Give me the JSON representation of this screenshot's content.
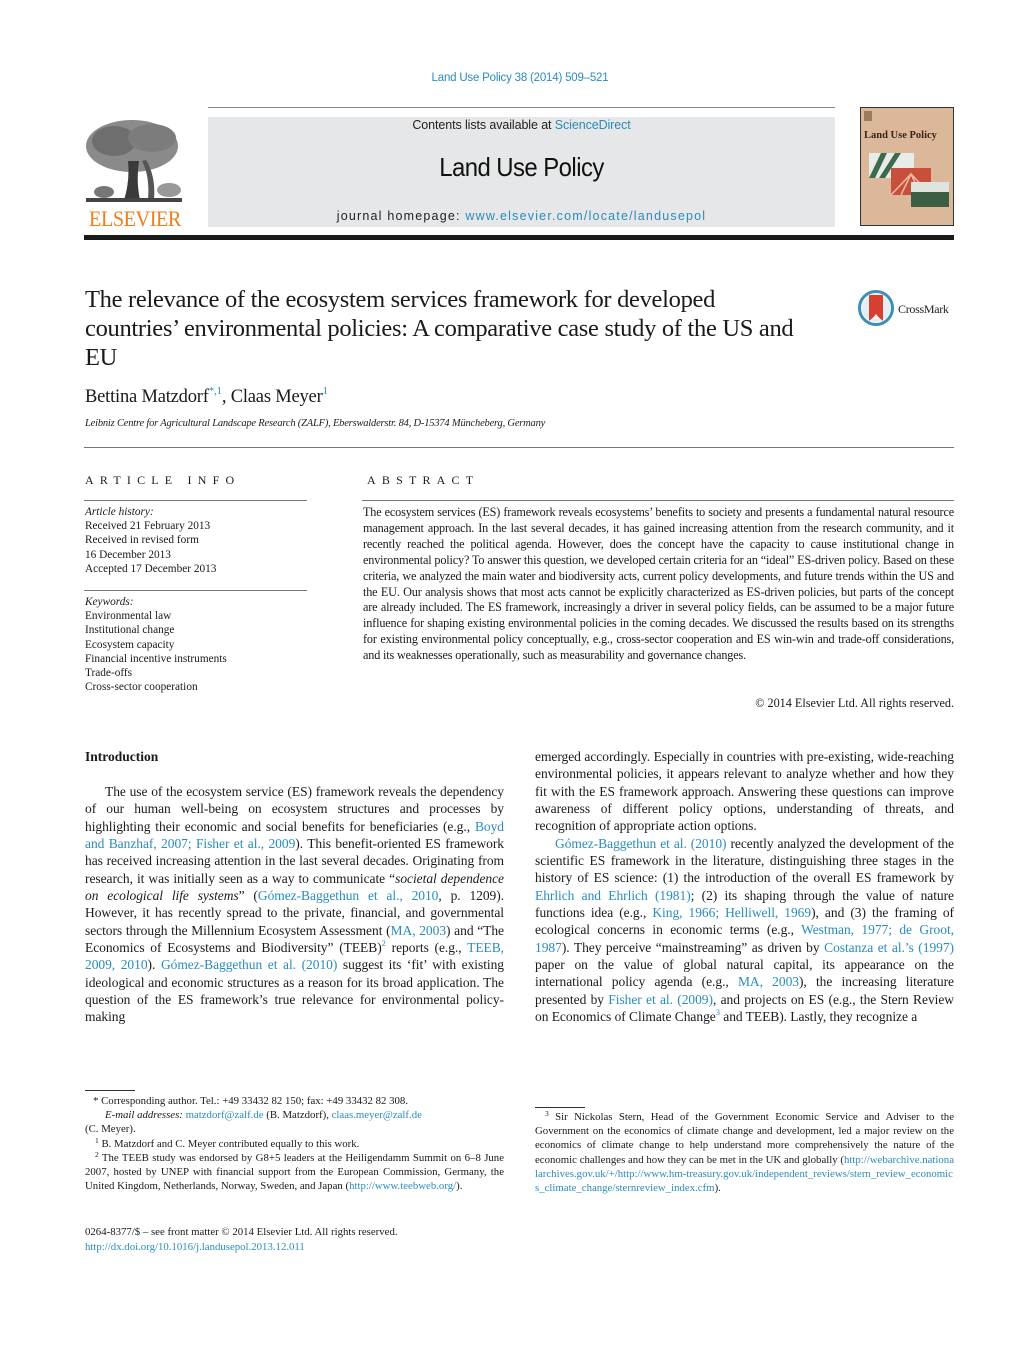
{
  "journal_ref": "Land Use Policy 38 (2014) 509–521",
  "header": {
    "publisher_logo_text": "ELSEVIER",
    "contents_prefix": "Contents lists available at ",
    "contents_link": "ScienceDirect",
    "journal_title": "Land Use Policy",
    "homepage_prefix": "journal homepage: ",
    "homepage_link": "www.elsevier.com/locate/landusepol",
    "cover_title": "Land Use Policy"
  },
  "article": {
    "title": "The relevance of the ecosystem services framework for developed countries’ environmental policies: A comparative case study of the US and EU",
    "crossmark_label": "CrossMark",
    "authors": [
      {
        "name": "Bettina Matzdorf",
        "marks": "*,1"
      },
      {
        "name": "Claas Meyer",
        "marks": "1"
      }
    ],
    "author_separator": ", ",
    "affiliation": "Leibniz Centre for Agricultural Landscape Research (ZALF), Eberswalderstr. 84, D-15374 Müncheberg, Germany"
  },
  "article_info": {
    "heading": "ARTICLE INFO",
    "history_label": "Article history:",
    "history": [
      "Received 21 February 2013",
      "Received in revised form",
      "16 December 2013",
      "Accepted 17 December 2013"
    ],
    "keywords_label": "Keywords:",
    "keywords": [
      "Environmental law",
      "Institutional change",
      "Ecosystem capacity",
      "Financial incentive instruments",
      "Trade-offs",
      "Cross-sector cooperation"
    ]
  },
  "abstract": {
    "heading": "ABSTRACT",
    "text": "The ecosystem services (ES) framework reveals ecosystems’ benefits to society and presents a fundamental natural resource management approach. In the last several decades, it has gained increasing attention from the research community, and it recently reached the political agenda. However, does the concept have the capacity to cause institutional change in environmental policy? To answer this question, we developed certain criteria for an “ideal” ES-driven policy. Based on these criteria, we analyzed the main water and biodiversity acts, current policy developments, and future trends within the US and the EU. Our analysis shows that most acts cannot be explicitly characterized as ES-driven policies, but parts of the concept are already included. The ES framework, increasingly a driver in several policy fields, can be assumed to be a major future influence for shaping existing environmental policies in the coming decades. We discussed the results based on its strengths for existing environmental policy conceptually, e.g., cross-sector cooperation and ES win-win and trade-off considerations, and its weaknesses operationally, such as measurability and governance changes.",
    "copyright": "© 2014 Elsevier Ltd. All rights reserved."
  },
  "body": {
    "section_heading": "Introduction",
    "left": {
      "t1": "The use of the ecosystem service (ES) framework reveals the dependency of our human well-being on ecosystem structures and processes by highlighting their economic and social benefits for beneficiaries (e.g., ",
      "l1": "Boyd and Banzhaf, 2007; Fisher et al., 2009",
      "t2": "). This benefit-oriented ES framework has received increasing attention in the last several decades. Originating from research, it was initially seen as a way to communicate “",
      "i1": "societal dependence on ecological life systems",
      "t3": "” (",
      "l2": "Gómez-Baggethun et al., 2010",
      "t4": ", p. 1209). However, it has recently spread to the private, financial, and governmental sectors through the Millennium Ecosystem Assessment (",
      "l3": "MA, 2003",
      "t5": ") and “The Economics of Ecosystems and Biodiversity” (TEEB)",
      "fn2": "2",
      "t6": " reports (e.g., ",
      "l4": "TEEB, 2009, 2010",
      "t7": "). ",
      "l5": "Gómez-Baggethun et al. (2010)",
      "t8": " suggest its ‘fit’ with existing ideological and economic structures as a reason for its broad application. The question of the ES framework’s true relevance for environmental policy-making"
    },
    "right": {
      "p1": "emerged accordingly. Especially in countries with pre-existing, wide-reaching environmental policies, it appears relevant to analyze whether and how they fit with the ES framework approach. Answering these questions can improve awareness of different policy options, understanding of threats, and recognition of appropriate action options.",
      "l1": "Gómez-Baggethun et al. (2010)",
      "t1": " recently analyzed the development of the scientific ES framework in the literature, distinguishing three stages in the history of ES science: (1) the introduction of the overall ES framework by ",
      "l2": "Ehrlich and Ehrlich (1981)",
      "t2": "; (2) its shaping through the value of nature functions idea (e.g., ",
      "l3": "King, 1966; Helliwell, 1969",
      "t3": "), and (3) the framing of ecological concerns in economic terms (e.g., ",
      "l4": "Westman, 1977; de Groot, 1987",
      "t4": "). They perceive “mainstreaming” as driven by ",
      "l5": "Costanza et al.’s (1997)",
      "t5": " paper on the value of global natural capital, its appearance on the international policy agenda (e.g., ",
      "l6": "MA, 2003",
      "t6": "), the increasing literature presented by ",
      "l7": "Fisher et al. (2009)",
      "t7": ", and projects on ES (e.g., the Stern Review on Economics of Climate Change",
      "fn3": "3",
      "t8": " and TEEB). Lastly, they recognize a"
    }
  },
  "footnotes": {
    "corresponding": "* Corresponding author. Tel.: +49 33432 82 150; fax: +49 33432 82 308.",
    "email_label": "E-mail addresses:",
    "email1": "matzdorf@zalf.de",
    "email1_owner": " (B. Matzdorf), ",
    "email2": "claas.meyer@zalf.de",
    "email2_owner": "(C. Meyer).",
    "fn1_mark": "1",
    "fn1": " B. Matzdorf and C. Meyer contributed equally to this work.",
    "fn2_mark": "2",
    "fn2": " The TEEB study was endorsed by G8+5 leaders at the Heiligendamm Summit on 6–8 June 2007, hosted by UNEP with financial support from the European Commission, Germany, the United Kingdom, Netherlands, Norway, Sweden, and Japan (",
    "fn2_link": "http://www.teebweb.org/",
    "fn2_end": ").",
    "fn3_mark": "3",
    "fn3": " Sir Nickolas Stern, Head of the Government Economic Service and Adviser to the Government on the economics of climate change and development, led a major review on the economics of climate change to help understand more comprehensively the nature of the economic challenges and how they can be met in the UK and globally (",
    "fn3_link": "http://webarchive.nationalarchives.gov.uk/+/http://www.hm-treasury.gov.uk/independent_reviews/stern_review_economics_climate_change/sternreview_index.cfm",
    "fn3_end": ")."
  },
  "front_matter": {
    "issn_line": "0264-8377/$ – see front matter © 2014 Elsevier Ltd. All rights reserved.",
    "doi": "http://dx.doi.org/10.1016/j.landusepol.2013.12.011"
  },
  "colors": {
    "link": "#2a8cba",
    "elsevier_orange": "#f07c1a",
    "masthead_gray": "#e6e7e8",
    "cover_tan": "#dcb89b"
  }
}
